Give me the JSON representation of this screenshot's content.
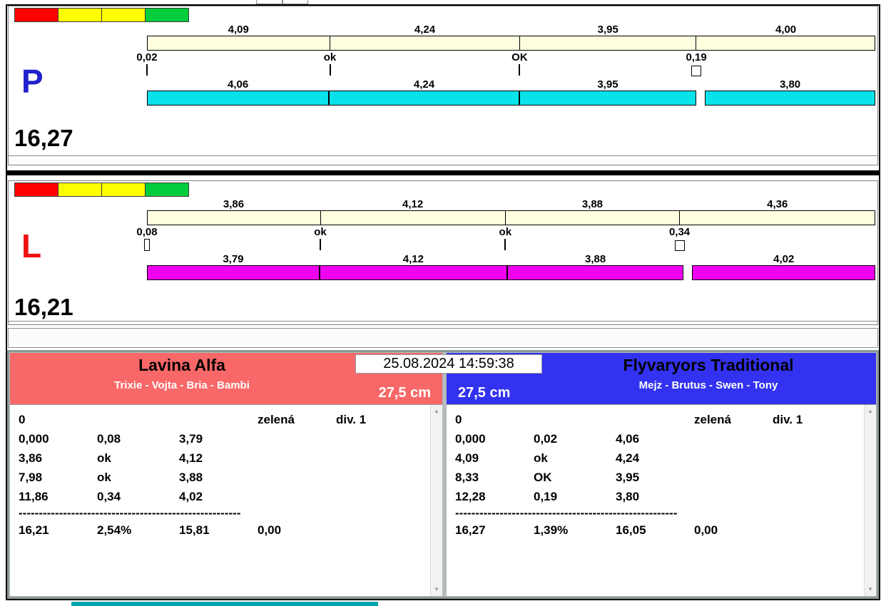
{
  "window": {
    "timestamp": "25.08.2024 14:59:38"
  },
  "icons": {
    "scroll_up": "▲",
    "scroll_down": "▼"
  },
  "traffic_light": [
    "#FF0000",
    "#FFFF00",
    "#FFFF00",
    "#00CC3C"
  ],
  "lanes": [
    {
      "letter": "P",
      "letter_color": "#2020CC",
      "total": "16,27",
      "upper_times": [
        "4,09",
        "4,24",
        "3,95",
        "4,00"
      ],
      "markers": [
        "0,02",
        "ok",
        "OK",
        "0,19"
      ],
      "marker_indicators": [
        "tick",
        "tick",
        "tick",
        "checkbox"
      ],
      "lower_times": [
        "4,06",
        "4,24",
        "3,95",
        "3,80"
      ],
      "bar_color": "#0AE2EA"
    },
    {
      "letter": "L",
      "letter_color": "#EE1111",
      "total": "16,21",
      "upper_times": [
        "3,86",
        "4,12",
        "3,88",
        "4,36"
      ],
      "markers": [
        "0,08",
        "ok",
        "ok",
        "0,34"
      ],
      "marker_indicators": [
        "slimbox",
        "tick",
        "tick",
        "checkbox"
      ],
      "lower_times": [
        "3,79",
        "4,12",
        "3,88",
        "4,02"
      ],
      "bar_color": "#EE00EE"
    }
  ],
  "teams": [
    {
      "name": "Lavina Alfa",
      "members": "Trixie - Vojta - Bria - Bambi",
      "height": "27,5 cm",
      "header_color": "#F96868",
      "info_row": [
        "0",
        "zelená",
        "div. 1"
      ],
      "rows": [
        [
          "0,000",
          "0,08",
          "3,79"
        ],
        [
          "3,86",
          "ok",
          "4,12"
        ],
        [
          "7,98",
          "ok",
          "3,88"
        ],
        [
          "11,86",
          "0,34",
          "4,02"
        ]
      ],
      "separator": "-------------------------------------------------------",
      "total_row": [
        "16,21",
        "2,54%",
        "15,81",
        "0,00"
      ]
    },
    {
      "name": "Flyvaryors Traditional",
      "members": "Mejz - Brutus - Swen - Tony",
      "height": "27,5 cm",
      "header_color": "#3232F0",
      "info_row": [
        "0",
        "zelená",
        "div. 1"
      ],
      "rows": [
        [
          "0,000",
          "0,02",
          "4,06"
        ],
        [
          "4,09",
          "ok",
          "4,24"
        ],
        [
          "8,33",
          "OK",
          "3,95"
        ],
        [
          "12,28",
          "0,19",
          "3,80"
        ]
      ],
      "separator": "-------------------------------------------------------",
      "total_row": [
        "16,27",
        "1,39%",
        "16,05",
        "0,00"
      ]
    }
  ]
}
